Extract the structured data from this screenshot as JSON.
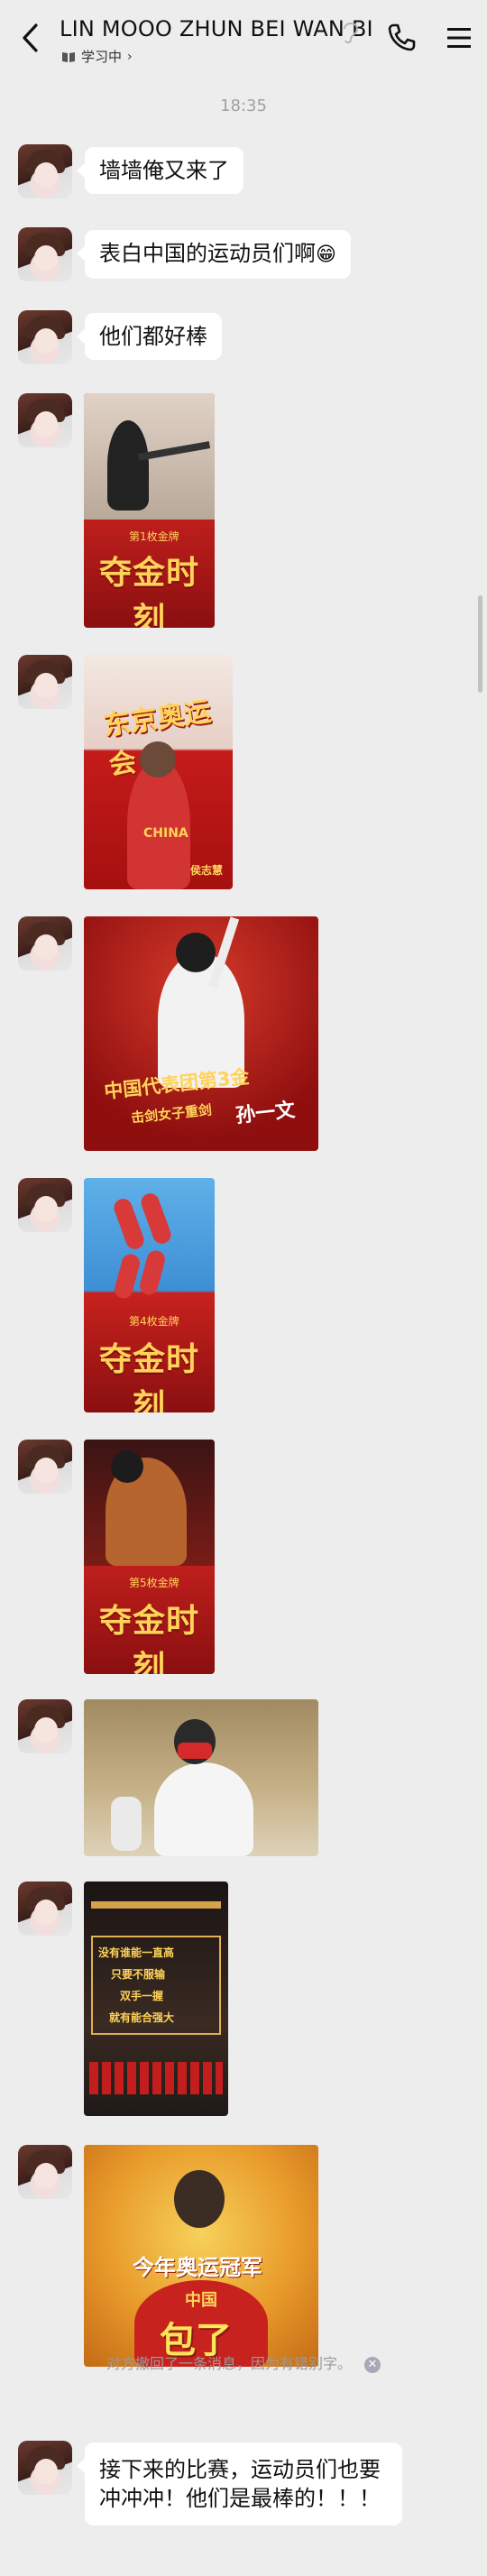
{
  "header": {
    "title": "LIN MOOO ZHUN BEI WAN BI",
    "status": "学习中",
    "status_icon": "book-icon",
    "icons": [
      "back-icon",
      "ear-icon",
      "phone-icon",
      "menu-icon"
    ]
  },
  "chat": {
    "timestamp": "18:35",
    "messages": [
      {
        "type": "text",
        "text": "墙墙俺又来了"
      },
      {
        "type": "text",
        "text": "表白中国的运动员们啊",
        "emoji": "😁"
      },
      {
        "type": "text",
        "text": "他们都好棒"
      },
      {
        "type": "image",
        "caption": "夺金时刻",
        "badge": "第1枚金牌"
      },
      {
        "type": "image",
        "caption": "东京奥运会",
        "badge": "CHINA",
        "name": "侯志慧"
      },
      {
        "type": "image",
        "caption": "中国代表团第3金",
        "sub": "击剑女子重剑",
        "name": "孙一文"
      },
      {
        "type": "image",
        "caption": "夺金时刻",
        "badge": "第4枚金牌"
      },
      {
        "type": "image",
        "caption": "夺金时刻",
        "badge": "第5枚金牌"
      },
      {
        "type": "image",
        "caption": ""
      },
      {
        "type": "image",
        "lines": [
          "没有谁能一直高",
          "只要不服输",
          "双手一握",
          "就有能合强大"
        ]
      },
      {
        "type": "image",
        "caption": "今年奥运冠军",
        "sub": "中国",
        "punch": "包了"
      },
      {
        "type": "text",
        "text": "接下来的比赛，运动员们也要冲冲冲！他们是最棒的！！！"
      }
    ],
    "recall_notice": "对方撤回了一条消息，因为有错别字。"
  },
  "colors": {
    "background": "#ededed",
    "bubble": "#ffffff",
    "gold": "#ffd35a",
    "red": "#c8221e"
  }
}
